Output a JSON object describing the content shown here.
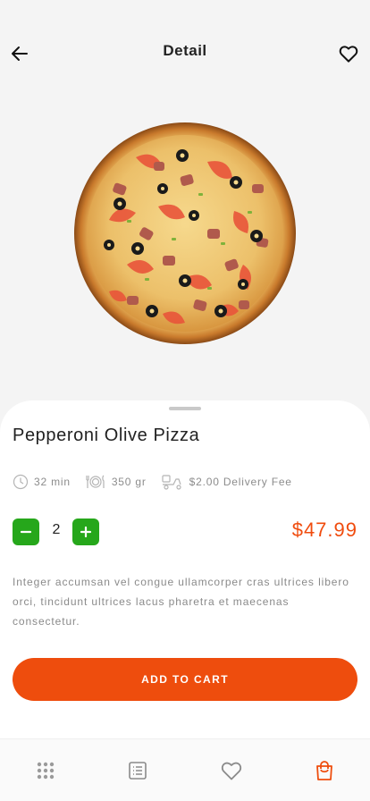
{
  "header": {
    "title": "Detail",
    "back_icon": "arrow-left-icon",
    "favorite_icon": "heart-icon"
  },
  "product": {
    "image_icon": "pizza-image",
    "name": "Pepperoni Olive Pizza",
    "meta": {
      "time": "32 min",
      "weight": "350 gr",
      "delivery": "$2.00 Delivery Fee"
    },
    "quantity": "2",
    "price": "$47.99",
    "description": "Integer accumsan vel congue ullamcorper cras ultrices libero orci, tincidunt ultrices lacus pharetra et maecenas consectetur."
  },
  "actions": {
    "add_to_cart": "ADD TO CART"
  },
  "bottom_nav": {
    "items": [
      "grid-icon",
      "list-icon",
      "heart-icon",
      "shopping-bag-icon"
    ]
  },
  "colors": {
    "accent": "#ee4d0d",
    "price": "#f04c0e",
    "green": "#26a71b",
    "muted": "#8c8c8c"
  }
}
